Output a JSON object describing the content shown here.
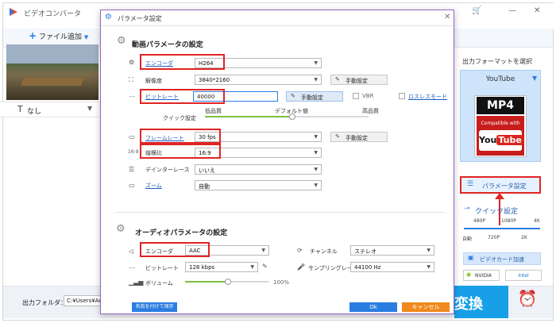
{
  "app": {
    "title": "ビデオコンバータ",
    "add_file": "ファイル追加",
    "subtitle_select": "なし",
    "output_folder_label": "出力フォルダ：",
    "output_folder_value": "C:¥Users¥Adm",
    "convert_label": "変換",
    "minimize": "—",
    "close": "✕"
  },
  "right_panel": {
    "output_format_title": "出力フォーマットを選択",
    "format_name": "YouTube",
    "mp4_badge": "MP4",
    "compatible_with": "Compatible with",
    "youtube_you": "You",
    "youtube_tube": "Tube",
    "param_settings": "パラメータ設定",
    "quick_settings": "クイック設定",
    "quick_top": [
      "480P",
      "1080P",
      "4K"
    ],
    "quick_bottom": [
      "自動",
      "720P",
      "2K"
    ],
    "gpu_accel": "ビデオカード加速",
    "nvidia": "NVIDIA",
    "intel": "Intel"
  },
  "dialog": {
    "title": "パラメータ設定",
    "video_section": "動画パラメータの設定",
    "audio_section": "オーディオパラメータの設定",
    "video": {
      "encoder_label": "エンコーダ",
      "encoder_value": "H264",
      "resolution_label": "解像度",
      "resolution_value": "3840*2160",
      "bitrate_label": "ビットレート",
      "bitrate_value": "40000",
      "framerate_label": "フレームレート",
      "framerate_value": "30 fps",
      "aspect_label": "縦横比",
      "aspect_value": "16:9",
      "deinterlace_label": "デインターレース",
      "deinterlace_value": "いいえ",
      "zoom_label": "ズーム",
      "zoom_value": "自動",
      "manual_settings": "手動設定",
      "vbr": "VBR",
      "lossless": "ロスレスモード",
      "quick_settings_label": "クイック設定",
      "quality_low": "低品質",
      "quality_default": "デフォルト値",
      "quality_high": "高品質"
    },
    "audio": {
      "encoder_label": "エンコーダ",
      "encoder_value": "AAC",
      "bitrate_label": "ビットレート",
      "bitrate_value": "128 kbps",
      "volume_label": "ボリューム",
      "volume_value": "100%",
      "channel_label": "チャンネル",
      "channel_value": "ステレオ",
      "samplerate_label": "サンプリングレート",
      "samplerate_value": "44100 Hz"
    },
    "footer": {
      "save_named": "名前を付けて保存",
      "ok": "Ok",
      "cancel": "キャンセル"
    }
  },
  "colors": {
    "accent": "#2a7de1",
    "highlight": "#e02424",
    "convert": "#17a0e8",
    "cancel": "#f08a1c",
    "dialog_border": "#9b63c7"
  }
}
